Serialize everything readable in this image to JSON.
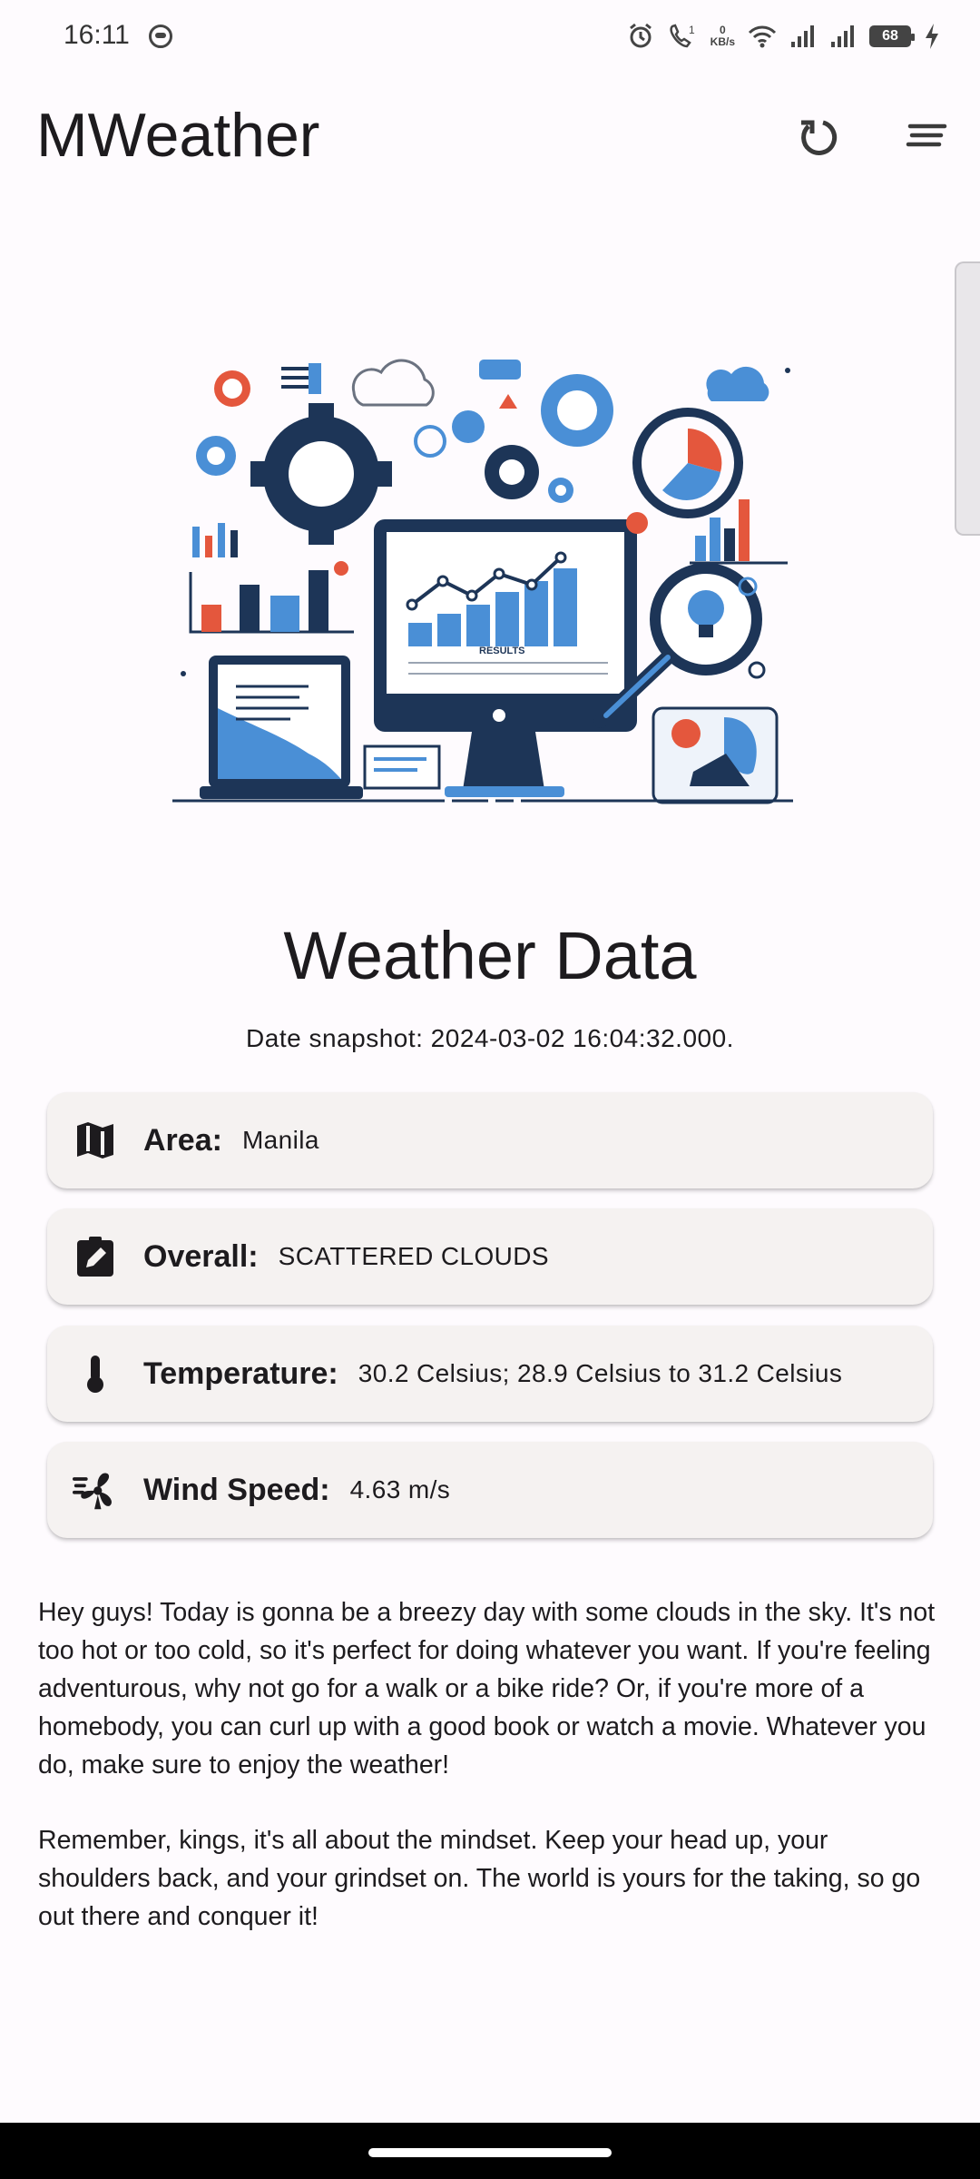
{
  "status_bar": {
    "time": "16:11",
    "net_speed_value": "0",
    "net_speed_unit": "KB/s",
    "battery": "68",
    "icons": [
      "notification-icon",
      "alarm-icon",
      "wifi-call-icon",
      "wifi-icon",
      "signal-icon",
      "signal-icon",
      "battery-icon",
      "charging-icon"
    ]
  },
  "app_bar": {
    "title": "MWeather",
    "actions": [
      "refresh-icon",
      "menu-icon"
    ]
  },
  "hero": {
    "image_text": "RESULTS"
  },
  "weather": {
    "title": "Weather Data",
    "snapshot": "Date snapshot: 2024-03-02 16:04:32.000.",
    "rows": [
      {
        "icon": "map-icon",
        "label": "Area:",
        "value": "Manila"
      },
      {
        "icon": "clipboard-edit-icon",
        "label": "Overall:",
        "value": "SCATTERED CLOUDS"
      },
      {
        "icon": "thermometer-icon",
        "label": "Temperature:",
        "value": "30.2 Celsius; 28.9 Celsius to 31.2 Celsius"
      },
      {
        "icon": "wind-fan-icon",
        "label": "Wind Speed:",
        "value": "4.63 m/s"
      }
    ]
  },
  "description": {
    "paragraph1": "Hey guys! Today is gonna be a breezy day with some clouds in the sky. It's not too hot or too cold, so it's perfect for doing whatever you want. If you're feeling adventurous, why not go for a walk or a bike ride? Or, if you're more of a homebody, you can curl up with a good book or watch a movie. Whatever you do, make sure to enjoy the weather!",
    "paragraph2": "Remember, kings, it's all about the mindset. Keep your head up, your shoulders back, and your grindset on. The world is yours for the taking, so go out there and conquer it!"
  },
  "colors": {
    "background": "#fefbfe",
    "card": "#f5f2f1",
    "accent_blue": "#4a8fd6",
    "navy": "#1d3557",
    "accent_orange": "#e4573d"
  }
}
